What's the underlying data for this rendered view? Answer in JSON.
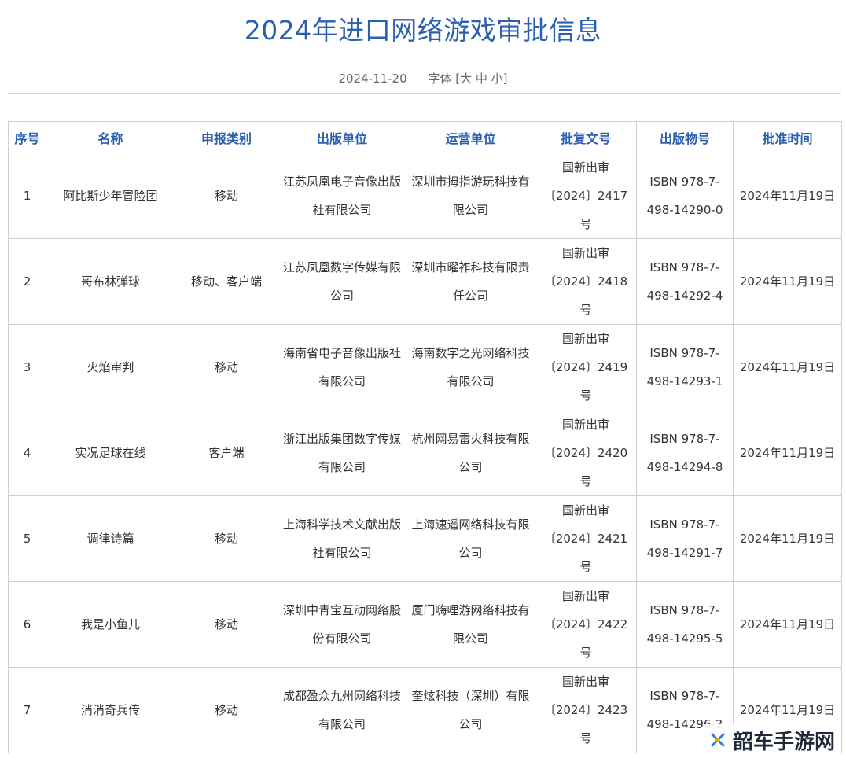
{
  "page": {
    "title": "2024年进口网络游戏审批信息",
    "date": "2024-11-20",
    "font_label": "字体 [",
    "font_large": "大",
    "font_medium": "中",
    "font_small": "小",
    "font_close": "]"
  },
  "table": {
    "headers": [
      "序号",
      "名称",
      "申报类别",
      "出版单位",
      "运营单位",
      "批复文号",
      "出版物号",
      "批准时间"
    ],
    "rows": [
      [
        "1",
        "阿比斯少年冒险团",
        "移动",
        "江苏凤凰电子音像出版社有限公司",
        "深圳市拇指游玩科技有限公司",
        "国新出审〔2024〕2417号",
        "ISBN 978-7-498-14290-0",
        "2024年11月19日"
      ],
      [
        "2",
        "哥布林弹球",
        "移动、客户端",
        "江苏凤凰数字传媒有限公司",
        "深圳市曜祚科技有限责任公司",
        "国新出审〔2024〕2418号",
        "ISBN 978-7-498-14292-4",
        "2024年11月19日"
      ],
      [
        "3",
        "火焰审判",
        "移动",
        "海南省电子音像出版社有限公司",
        "海南数字之光网络科技有限公司",
        "国新出审〔2024〕2419号",
        "ISBN 978-7-498-14293-1",
        "2024年11月19日"
      ],
      [
        "4",
        "实况足球在线",
        "客户端",
        "浙江出版集团数字传媒有限公司",
        "杭州网易雷火科技有限公司",
        "国新出审〔2024〕2420号",
        "ISBN 978-7-498-14294-8",
        "2024年11月19日"
      ],
      [
        "5",
        "调律诗篇",
        "移动",
        "上海科学技术文献出版社有限公司",
        "上海速遥网络科技有限公司",
        "国新出审〔2024〕2421号",
        "ISBN 978-7-498-14291-7",
        "2024年11月19日"
      ],
      [
        "6",
        "我是小鱼儿",
        "移动",
        "深圳中青宝互动网络股份有限公司",
        "厦门嗨哩游网络科技有限公司",
        "国新出审〔2024〕2422号",
        "ISBN 978-7-498-14295-5",
        "2024年11月19日"
      ],
      [
        "7",
        "消消奇兵传",
        "移动",
        "成都盈众九州网络科技有限公司",
        "奎炫科技（深圳）有限公司",
        "国新出审〔2024〕2423号",
        "ISBN 978-7-498-14296-2",
        "2024年11月19日"
      ]
    ]
  },
  "watermark": {
    "text": "韶车手游网"
  },
  "colors": {
    "accent": "#2b5fb0",
    "border": "#cfcfcf"
  }
}
